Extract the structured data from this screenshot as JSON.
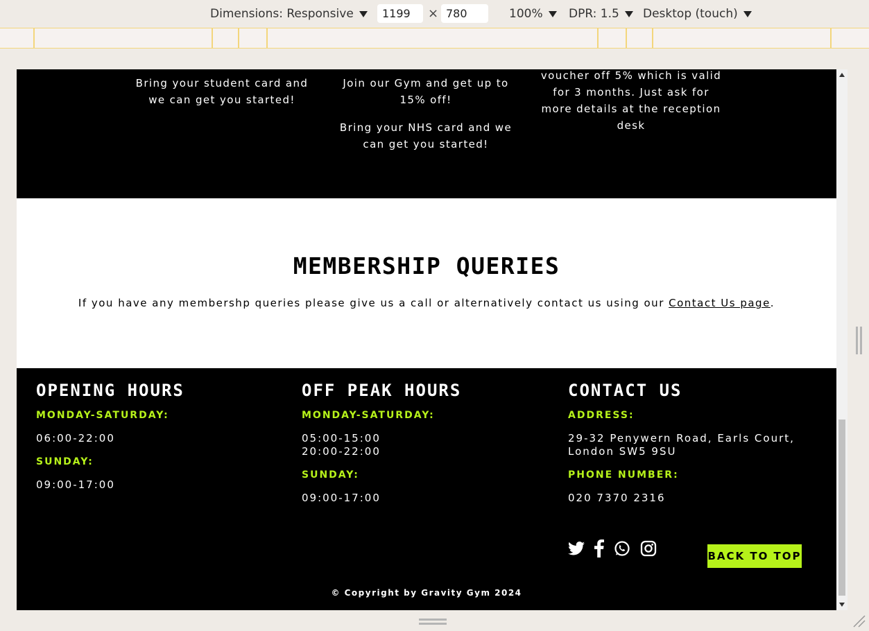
{
  "devtools": {
    "dimensions_label": "Dimensions: Responsive",
    "width_value": "1199",
    "times": "×",
    "height_value": "780",
    "zoom": "100%",
    "dpr": "DPR: 1.5",
    "device_mode": "Desktop (touch)"
  },
  "offers": {
    "student": "Bring your student card and we can get you started!",
    "nhs_line1": "Join our Gym and get up to 15% off!",
    "nhs_line2": "Bring your NHS card and we can get you started!",
    "voucher": "voucher off 5% which is valid for 3 months. Just ask for more details at the reception desk"
  },
  "membership": {
    "title": "MEMBERSHIP QUERIES",
    "text_before": "If you have any membershp queries please give us a call or alternatively contact us using our ",
    "link_text": "Contact Us page",
    "text_after": "."
  },
  "footer": {
    "opening": {
      "title": "OPENING HOURS",
      "weekday_label": "MONDAY-SATURDAY:",
      "weekday_hours": "06:00-22:00",
      "sunday_label": "SUNDAY:",
      "sunday_hours": "09:00-17:00"
    },
    "offpeak": {
      "title": "OFF PEAK HOURS",
      "weekday_label": "MONDAY-SATURDAY:",
      "weekday_hours_1": "05:00-15:00",
      "weekday_hours_2": "20:00-22:00",
      "sunday_label": "SUNDAY:",
      "sunday_hours": "09:00-17:00"
    },
    "contact": {
      "title": "CONTACT US",
      "address_label": "ADDRESS:",
      "address_line1": "29-32 Penywern Road, Earls Court,",
      "address_line2": "London SW5 9SU",
      "phone_label": "PHONE NUMBER:",
      "phone": "020 7370 2316"
    },
    "socials": [
      "twitter-icon",
      "facebook-icon",
      "whatsapp-icon",
      "instagram-icon"
    ],
    "back_to_top": "BACK TO TOP",
    "copyright": "© Copyright by Gravity Gym 2024"
  },
  "colors": {
    "accent": "#b6f21a",
    "footer_bg": "#000000",
    "devtools_bg": "#efebe6"
  }
}
